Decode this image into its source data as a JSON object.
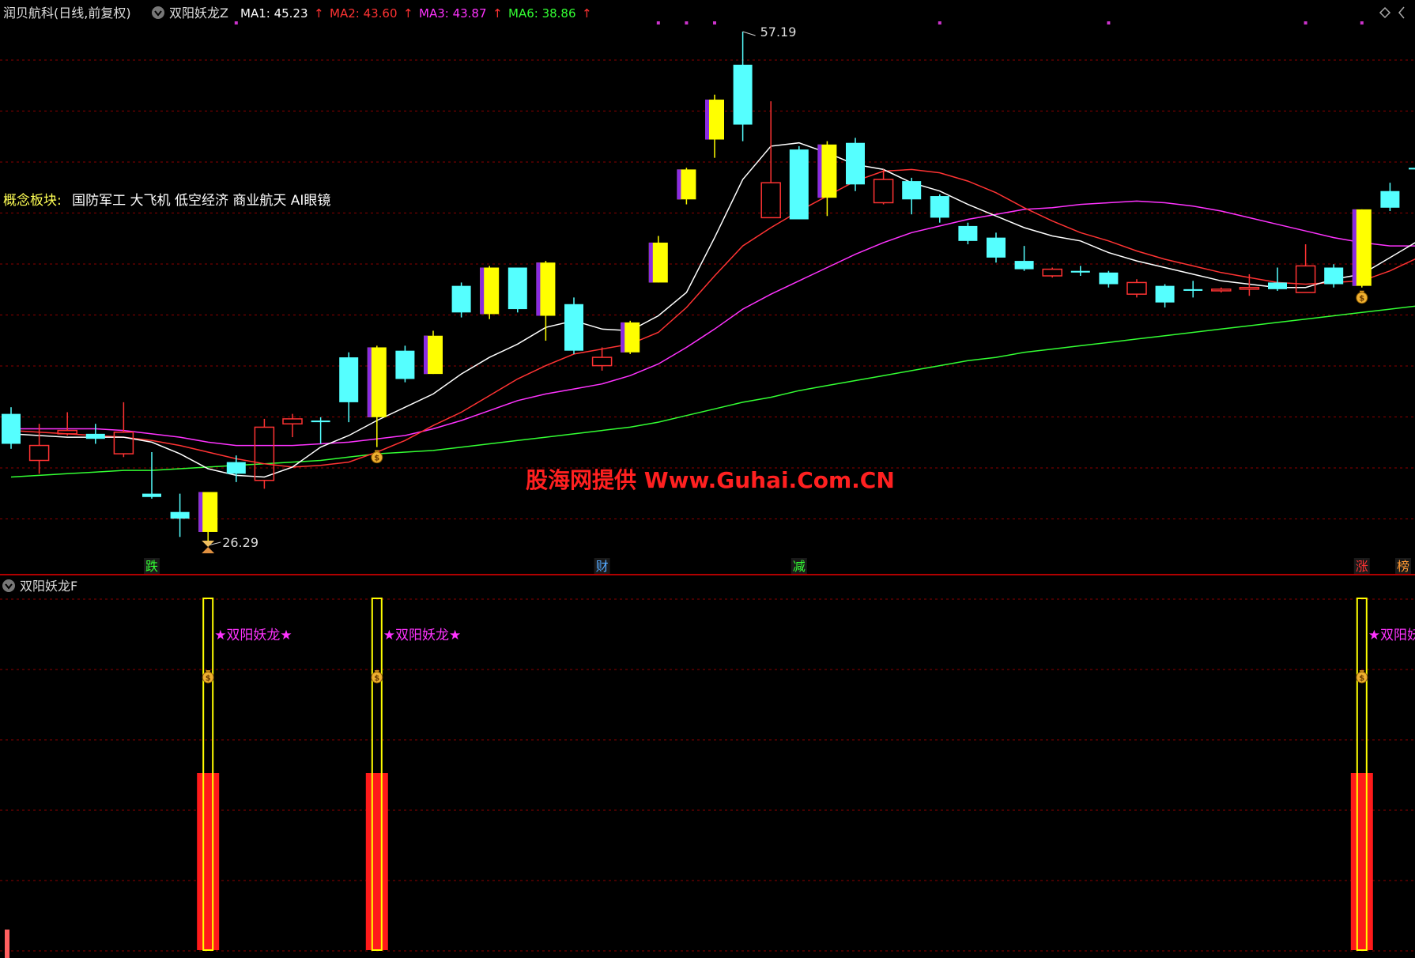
{
  "header": {
    "stock_name": "润贝航科(日线,前复权)",
    "indicator_name": "双阳妖龙Z",
    "ma": [
      {
        "label": "MA1: 45.23",
        "color": "#ffffff",
        "arrow": "↑"
      },
      {
        "label": "MA2: 43.60",
        "color": "#ff3333",
        "arrow": "↑"
      },
      {
        "label": "MA3: 43.87",
        "color": "#ff33ff",
        "arrow": "↑"
      },
      {
        "label": "MA6: 38.86",
        "color": "#33ff33",
        "arrow": "↑"
      }
    ]
  },
  "concept": {
    "label": "概念板块:",
    "value": "国防军工 大飞机 低空经济 商业航天 AI眼镜"
  },
  "price_labels": {
    "high": "57.19",
    "low": "26.29"
  },
  "watermark": "股海网提供 Www.Guhai.Com.CN",
  "bottom_markers": [
    "跌",
    "财",
    "减",
    "涨",
    "榜"
  ],
  "lower_panel": {
    "title": "双阳妖龙F",
    "signal_text": "★双阳妖龙★"
  },
  "colors": {
    "up_candle": "#ff3333",
    "down_candle": "#55ffff",
    "signal_candle": "#ffff00",
    "ma1": "#ffffff",
    "ma2": "#ff3333",
    "ma3": "#ff33ff",
    "ma6": "#33ff33",
    "grid": "#8b0000",
    "panel_border": "#b00000"
  },
  "chart_data": {
    "type": "candlestick",
    "y_range": [
      25,
      58
    ],
    "candles": [
      {
        "o": 34.2,
        "c": 32.4,
        "h": 34.6,
        "l": 32.1,
        "k": "d"
      },
      {
        "o": 31.4,
        "c": 32.3,
        "h": 33.6,
        "l": 30.6,
        "k": "u"
      },
      {
        "o": 33.0,
        "c": 33.2,
        "h": 34.3,
        "l": 32.9,
        "k": "u"
      },
      {
        "o": 33.0,
        "c": 32.7,
        "h": 33.6,
        "l": 32.4,
        "k": "d"
      },
      {
        "o": 31.8,
        "c": 33.1,
        "h": 34.9,
        "l": 31.6,
        "k": "u"
      },
      {
        "o": 29.4,
        "c": 29.2,
        "h": 31.9,
        "l": 29.1,
        "k": "d"
      },
      {
        "o": 28.3,
        "c": 27.9,
        "h": 29.4,
        "l": 26.8,
        "k": "d"
      },
      {
        "o": 29.5,
        "c": 27.1,
        "h": 29.5,
        "l": 26.29,
        "k": "y"
      },
      {
        "o": 31.3,
        "c": 30.6,
        "h": 31.7,
        "l": 30.1,
        "k": "d"
      },
      {
        "o": 30.2,
        "c": 33.4,
        "h": 33.9,
        "l": 29.7,
        "k": "u"
      },
      {
        "o": 33.6,
        "c": 33.9,
        "h": 34.2,
        "l": 32.8,
        "k": "u"
      },
      {
        "o": 33.8,
        "c": 33.7,
        "h": 34.0,
        "l": 32.4,
        "k": "d"
      },
      {
        "o": 37.6,
        "c": 34.9,
        "h": 37.9,
        "l": 33.7,
        "k": "d"
      },
      {
        "o": 34.0,
        "c": 38.2,
        "h": 38.3,
        "l": 32.2,
        "k": "y"
      },
      {
        "o": 38.0,
        "c": 36.3,
        "h": 38.3,
        "l": 36.1,
        "k": "d"
      },
      {
        "o": 36.6,
        "c": 38.9,
        "h": 39.2,
        "l": 36.6,
        "k": "y"
      },
      {
        "o": 41.9,
        "c": 40.3,
        "h": 42.1,
        "l": 40.0,
        "k": "d"
      },
      {
        "o": 40.2,
        "c": 43.0,
        "h": 43.1,
        "l": 39.9,
        "k": "y"
      },
      {
        "o": 43.0,
        "c": 40.5,
        "h": 43.0,
        "l": 40.3,
        "k": "d"
      },
      {
        "o": 40.1,
        "c": 43.3,
        "h": 43.4,
        "l": 38.6,
        "k": "y"
      },
      {
        "o": 40.8,
        "c": 38.0,
        "h": 41.2,
        "l": 37.8,
        "k": "d"
      },
      {
        "o": 37.1,
        "c": 37.6,
        "h": 38.2,
        "l": 36.8,
        "k": "u"
      },
      {
        "o": 37.9,
        "c": 39.7,
        "h": 39.8,
        "l": 37.8,
        "k": "y"
      },
      {
        "o": 42.1,
        "c": 44.5,
        "h": 44.9,
        "l": 42.1,
        "k": "y"
      },
      {
        "o": 47.1,
        "c": 48.9,
        "h": 49.0,
        "l": 46.8,
        "k": "y"
      },
      {
        "o": 50.7,
        "c": 53.1,
        "h": 53.4,
        "l": 49.6,
        "k": "y"
      },
      {
        "o": 55.2,
        "c": 51.6,
        "h": 57.19,
        "l": 50.6,
        "k": "d"
      },
      {
        "o": 46.0,
        "c": 48.1,
        "h": 53.0,
        "l": 46.0,
        "k": "u"
      },
      {
        "o": 50.1,
        "c": 45.9,
        "h": 50.3,
        "l": 45.9,
        "k": "d"
      },
      {
        "o": 47.2,
        "c": 50.4,
        "h": 50.6,
        "l": 46.1,
        "k": "y"
      },
      {
        "o": 50.5,
        "c": 48.0,
        "h": 50.8,
        "l": 47.6,
        "k": "d"
      },
      {
        "o": 46.9,
        "c": 48.3,
        "h": 48.9,
        "l": 46.8,
        "k": "u"
      },
      {
        "o": 48.2,
        "c": 47.1,
        "h": 48.4,
        "l": 46.2,
        "k": "d"
      },
      {
        "o": 47.3,
        "c": 46.0,
        "h": 47.4,
        "l": 45.7,
        "k": "d"
      },
      {
        "o": 45.5,
        "c": 44.6,
        "h": 45.7,
        "l": 44.4,
        "k": "d"
      },
      {
        "o": 44.8,
        "c": 43.6,
        "h": 45.1,
        "l": 43.3,
        "k": "d"
      },
      {
        "o": 43.4,
        "c": 42.9,
        "h": 44.3,
        "l": 42.8,
        "k": "d"
      },
      {
        "o": 42.5,
        "c": 42.9,
        "h": 43.0,
        "l": 42.4,
        "k": "u"
      },
      {
        "o": 42.8,
        "c": 42.7,
        "h": 43.1,
        "l": 42.5,
        "k": "d"
      },
      {
        "o": 42.7,
        "c": 42.0,
        "h": 42.8,
        "l": 41.8,
        "k": "d"
      },
      {
        "o": 41.4,
        "c": 42.1,
        "h": 42.3,
        "l": 41.2,
        "k": "u"
      },
      {
        "o": 41.9,
        "c": 40.9,
        "h": 42.0,
        "l": 40.6,
        "k": "d"
      },
      {
        "o": 41.7,
        "c": 41.6,
        "h": 42.2,
        "l": 41.2,
        "k": "d"
      },
      {
        "o": 41.6,
        "c": 41.7,
        "h": 41.8,
        "l": 41.5,
        "k": "u"
      },
      {
        "o": 41.7,
        "c": 41.8,
        "h": 42.6,
        "l": 41.3,
        "k": "u"
      },
      {
        "o": 42.1,
        "c": 41.7,
        "h": 43.0,
        "l": 41.6,
        "k": "d"
      },
      {
        "o": 41.5,
        "c": 43.1,
        "h": 44.4,
        "l": 41.5,
        "k": "u"
      },
      {
        "o": 43.0,
        "c": 42.0,
        "h": 43.2,
        "l": 41.8,
        "k": "d"
      },
      {
        "o": 41.9,
        "c": 46.5,
        "h": 46.5,
        "l": 41.8,
        "k": "y"
      },
      {
        "o": 47.6,
        "c": 46.6,
        "h": 48.1,
        "l": 46.4,
        "k": "d"
      },
      {
        "o": 49.0,
        "c": 48.9,
        "h": 51.4,
        "l": 47.8,
        "k": "d"
      }
    ],
    "ma1": [
      33.0,
      32.9,
      32.8,
      32.8,
      32.8,
      32.5,
      31.8,
      30.9,
      30.5,
      30.4,
      31.0,
      32.2,
      32.9,
      33.8,
      34.6,
      35.4,
      36.6,
      37.6,
      38.4,
      39.4,
      39.8,
      39.3,
      39.2,
      40.1,
      41.5,
      44.8,
      48.3,
      50.3,
      50.5,
      49.9,
      49.2,
      48.9,
      48.1,
      47.6,
      46.8,
      46.1,
      45.4,
      44.9,
      44.6,
      43.9,
      43.4,
      43.0,
      42.6,
      42.2,
      42.0,
      41.8,
      41.8,
      42.3,
      42.6,
      43.6,
      44.6
    ],
    "ma2": [
      33.2,
      33.1,
      33.0,
      32.9,
      32.8,
      32.6,
      32.3,
      31.9,
      31.5,
      31.2,
      31.0,
      31.1,
      31.3,
      31.9,
      32.6,
      33.5,
      34.3,
      35.3,
      36.3,
      37.1,
      37.8,
      38.1,
      38.4,
      39.1,
      40.6,
      42.5,
      44.3,
      45.4,
      46.4,
      47.3,
      48.2,
      48.8,
      48.9,
      48.7,
      48.2,
      47.5,
      46.6,
      45.8,
      45.1,
      44.6,
      44.0,
      43.5,
      43.1,
      42.7,
      42.4,
      42.1,
      42.0,
      42.1,
      42.2,
      42.8,
      43.6
    ],
    "ma3": [
      33.3,
      33.3,
      33.3,
      33.3,
      33.2,
      33.0,
      32.8,
      32.5,
      32.3,
      32.3,
      32.3,
      32.4,
      32.5,
      32.7,
      32.9,
      33.3,
      33.8,
      34.4,
      35.0,
      35.4,
      35.7,
      36.0,
      36.5,
      37.2,
      38.2,
      39.3,
      40.5,
      41.4,
      42.2,
      43.0,
      43.8,
      44.5,
      45.1,
      45.5,
      45.9,
      46.2,
      46.5,
      46.6,
      46.8,
      46.9,
      47.0,
      46.9,
      46.7,
      46.4,
      46.0,
      45.6,
      45.2,
      44.8,
      44.5,
      44.3,
      44.3
    ],
    "ma6": [
      30.4,
      30.5,
      30.6,
      30.7,
      30.8,
      30.8,
      30.9,
      31.0,
      31.1,
      31.2,
      31.3,
      31.4,
      31.6,
      31.8,
      31.9,
      32.0,
      32.2,
      32.4,
      32.6,
      32.8,
      33.0,
      33.2,
      33.4,
      33.7,
      34.1,
      34.5,
      34.9,
      35.2,
      35.6,
      35.9,
      36.2,
      36.5,
      36.8,
      37.1,
      37.4,
      37.6,
      37.9,
      38.1,
      38.3,
      38.5,
      38.7,
      38.9,
      39.1,
      39.3,
      39.5,
      39.7,
      39.9,
      40.1,
      40.3,
      40.5,
      40.7
    ],
    "signal_bars": [
      7,
      13,
      48
    ],
    "top_dots": [
      8,
      23,
      24,
      25,
      33,
      39,
      46,
      48
    ],
    "marker_bars": [
      5,
      21,
      28,
      48,
      50
    ]
  }
}
